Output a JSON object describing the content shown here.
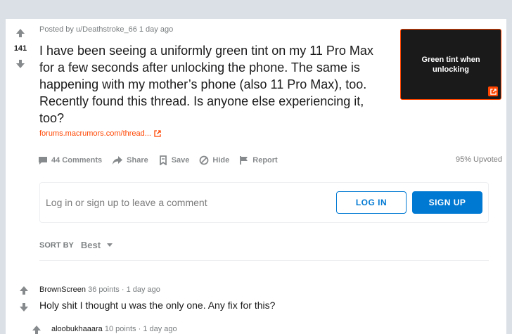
{
  "post": {
    "vote_count": "141",
    "meta": "Posted by u/Deathstroke_66 1 day ago",
    "title": "I have been seeing a uniformly green tint on my 11 Pro Max for a few seconds after unlocking the phone. The same is happening with my mother’s phone (also 11 Pro Max), too. Recently found this thread. Is anyone else experiencing it, too?",
    "link_text": "forums.macrumors.com/thread...",
    "thumbnail_text": "Green tint when unlocking",
    "actions": {
      "comments": "44 Comments",
      "share": "Share",
      "save": "Save",
      "hide": "Hide",
      "report": "Report"
    },
    "upvoted": "95% Upvoted"
  },
  "comment_box": {
    "prompt": "Log in or sign up to leave a comment",
    "login_label": "LOG IN",
    "signup_label": "SIGN UP"
  },
  "sort": {
    "label": "SORT BY",
    "value": "Best"
  },
  "comments": [
    {
      "author": "BrownScreen",
      "points": "36 points",
      "time": "1 day ago",
      "body": "Holy shit I thought u was the only one. Any fix for this?"
    },
    {
      "author": "aloobukhaaara",
      "points": "10 points",
      "time": "1 day ago",
      "body": ""
    }
  ],
  "colors": {
    "accent": "#0079d3",
    "link": "#ff4500",
    "background": "#dae0e6"
  },
  "icons": [
    "upvote-icon",
    "downvote-icon",
    "external-link-icon",
    "comment-icon",
    "share-icon",
    "save-icon",
    "hide-icon",
    "report-icon",
    "chevron-down-icon"
  ]
}
